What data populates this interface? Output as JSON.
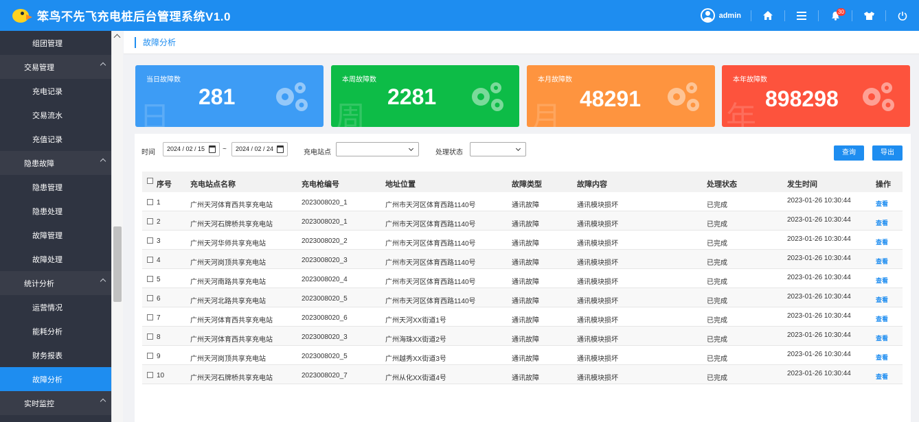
{
  "header": {
    "title": "笨鸟不先飞充电桩后台管理系统V1.0",
    "user": "admin",
    "notification_count": "30"
  },
  "sidebar": {
    "items": [
      {
        "label": "组团管理",
        "type": "sub"
      },
      {
        "label": "交易管理",
        "type": "group"
      },
      {
        "label": "充电记录",
        "type": "sub"
      },
      {
        "label": "交易流水",
        "type": "sub"
      },
      {
        "label": "充值记录",
        "type": "sub"
      },
      {
        "label": "隐患故障",
        "type": "group"
      },
      {
        "label": "隐患管理",
        "type": "sub"
      },
      {
        "label": "隐患处理",
        "type": "sub"
      },
      {
        "label": "故障管理",
        "type": "sub"
      },
      {
        "label": "故障处理",
        "type": "sub"
      },
      {
        "label": "统计分析",
        "type": "group"
      },
      {
        "label": "运营情况",
        "type": "sub"
      },
      {
        "label": "能耗分析",
        "type": "sub"
      },
      {
        "label": "财务报表",
        "type": "sub"
      },
      {
        "label": "故障分析",
        "type": "sub",
        "active": true
      },
      {
        "label": "实时监控",
        "type": "group"
      }
    ]
  },
  "breadcrumb": "故障分析",
  "stats": [
    {
      "label": "当日故障数",
      "value": "281",
      "watermark": "日",
      "color": "#3d9cf5"
    },
    {
      "label": "本周故障数",
      "value": "2281",
      "watermark": "周",
      "color": "#0dbc47"
    },
    {
      "label": "本月故障数",
      "value": "48291",
      "watermark": "月",
      "color": "#fe943f"
    },
    {
      "label": "本年故障数",
      "value": "898298",
      "watermark": "年",
      "color": "#fd533d"
    }
  ],
  "filters": {
    "time_label": "时间",
    "date_from": "2024 / 02 / 15",
    "date_sep": "~",
    "date_to": "2024 / 02 / 24",
    "station_label": "充电站点",
    "status_label": "处理状态",
    "query_label": "查询",
    "export_label": "导出"
  },
  "table": {
    "columns": [
      "序号",
      "充电站点名称",
      "充电枪编号",
      "地址位置",
      "故障类型",
      "故障内容",
      "处理状态",
      "发生时间",
      "操作"
    ],
    "rows": [
      [
        "1",
        "广州天河体育西共享充电站",
        "2023008020_1",
        "广州市天河区体育西路1140号",
        "通讯故障",
        "通讯模块损坏",
        "已完成",
        "2023-01-26 10:30:44",
        "查看"
      ],
      [
        "2",
        "广州天河石牌桥共享充电站",
        "2023008020_1",
        "广州市天河区体育西路1140号",
        "通讯故障",
        "通讯模块损坏",
        "已完成",
        "2023-01-26 10:30:44",
        "查看"
      ],
      [
        "3",
        "广州天河华师共享充电站",
        "2023008020_2",
        "广州市天河区体育西路1140号",
        "通讯故障",
        "通讯模块损坏",
        "已完成",
        "2023-01-26 10:30:44",
        "查看"
      ],
      [
        "4",
        "广州天河岗顶共享充电站",
        "2023008020_3",
        "广州市天河区体育西路1140号",
        "通讯故障",
        "通讯模块损坏",
        "已完成",
        "2023-01-26 10:30:44",
        "查看"
      ],
      [
        "5",
        "广州天河南路共享充电站",
        "2023008020_4",
        "广州市天河区体育西路1140号",
        "通讯故障",
        "通讯模块损坏",
        "已完成",
        "2023-01-26 10:30:44",
        "查看"
      ],
      [
        "6",
        "广州天河北路共享充电站",
        "2023008020_5",
        "广州市天河区体育西路1140号",
        "通讯故障",
        "通讯模块损坏",
        "已完成",
        "2023-01-26 10:30:44",
        "查看"
      ],
      [
        "7",
        "广州天河体育西共享充电站",
        "2023008020_6",
        "广州天河XX街道1号",
        "通讯故障",
        "通讯模块损坏",
        "已完成",
        "2023-01-26 10:30:44",
        "查看"
      ],
      [
        "8",
        "广州天河体育西共享充电站",
        "2023008020_3",
        "广州海珠XX街道2号",
        "通讯故障",
        "通讯模块损坏",
        "已完成",
        "2023-01-26 10:30:44",
        "查看"
      ],
      [
        "9",
        "广州天河岗顶共享充电站",
        "2023008020_5",
        "广州越秀XX街道3号",
        "通讯故障",
        "通讯模块损坏",
        "已完成",
        "2023-01-26 10:30:44",
        "查看"
      ],
      [
        "10",
        "广州天河石牌桥共享充电站",
        "2023008020_7",
        "广州从化XX街道4号",
        "通讯故障",
        "通讯模块损坏",
        "已完成",
        "2023-01-26 10:30:44",
        "查看"
      ]
    ]
  }
}
